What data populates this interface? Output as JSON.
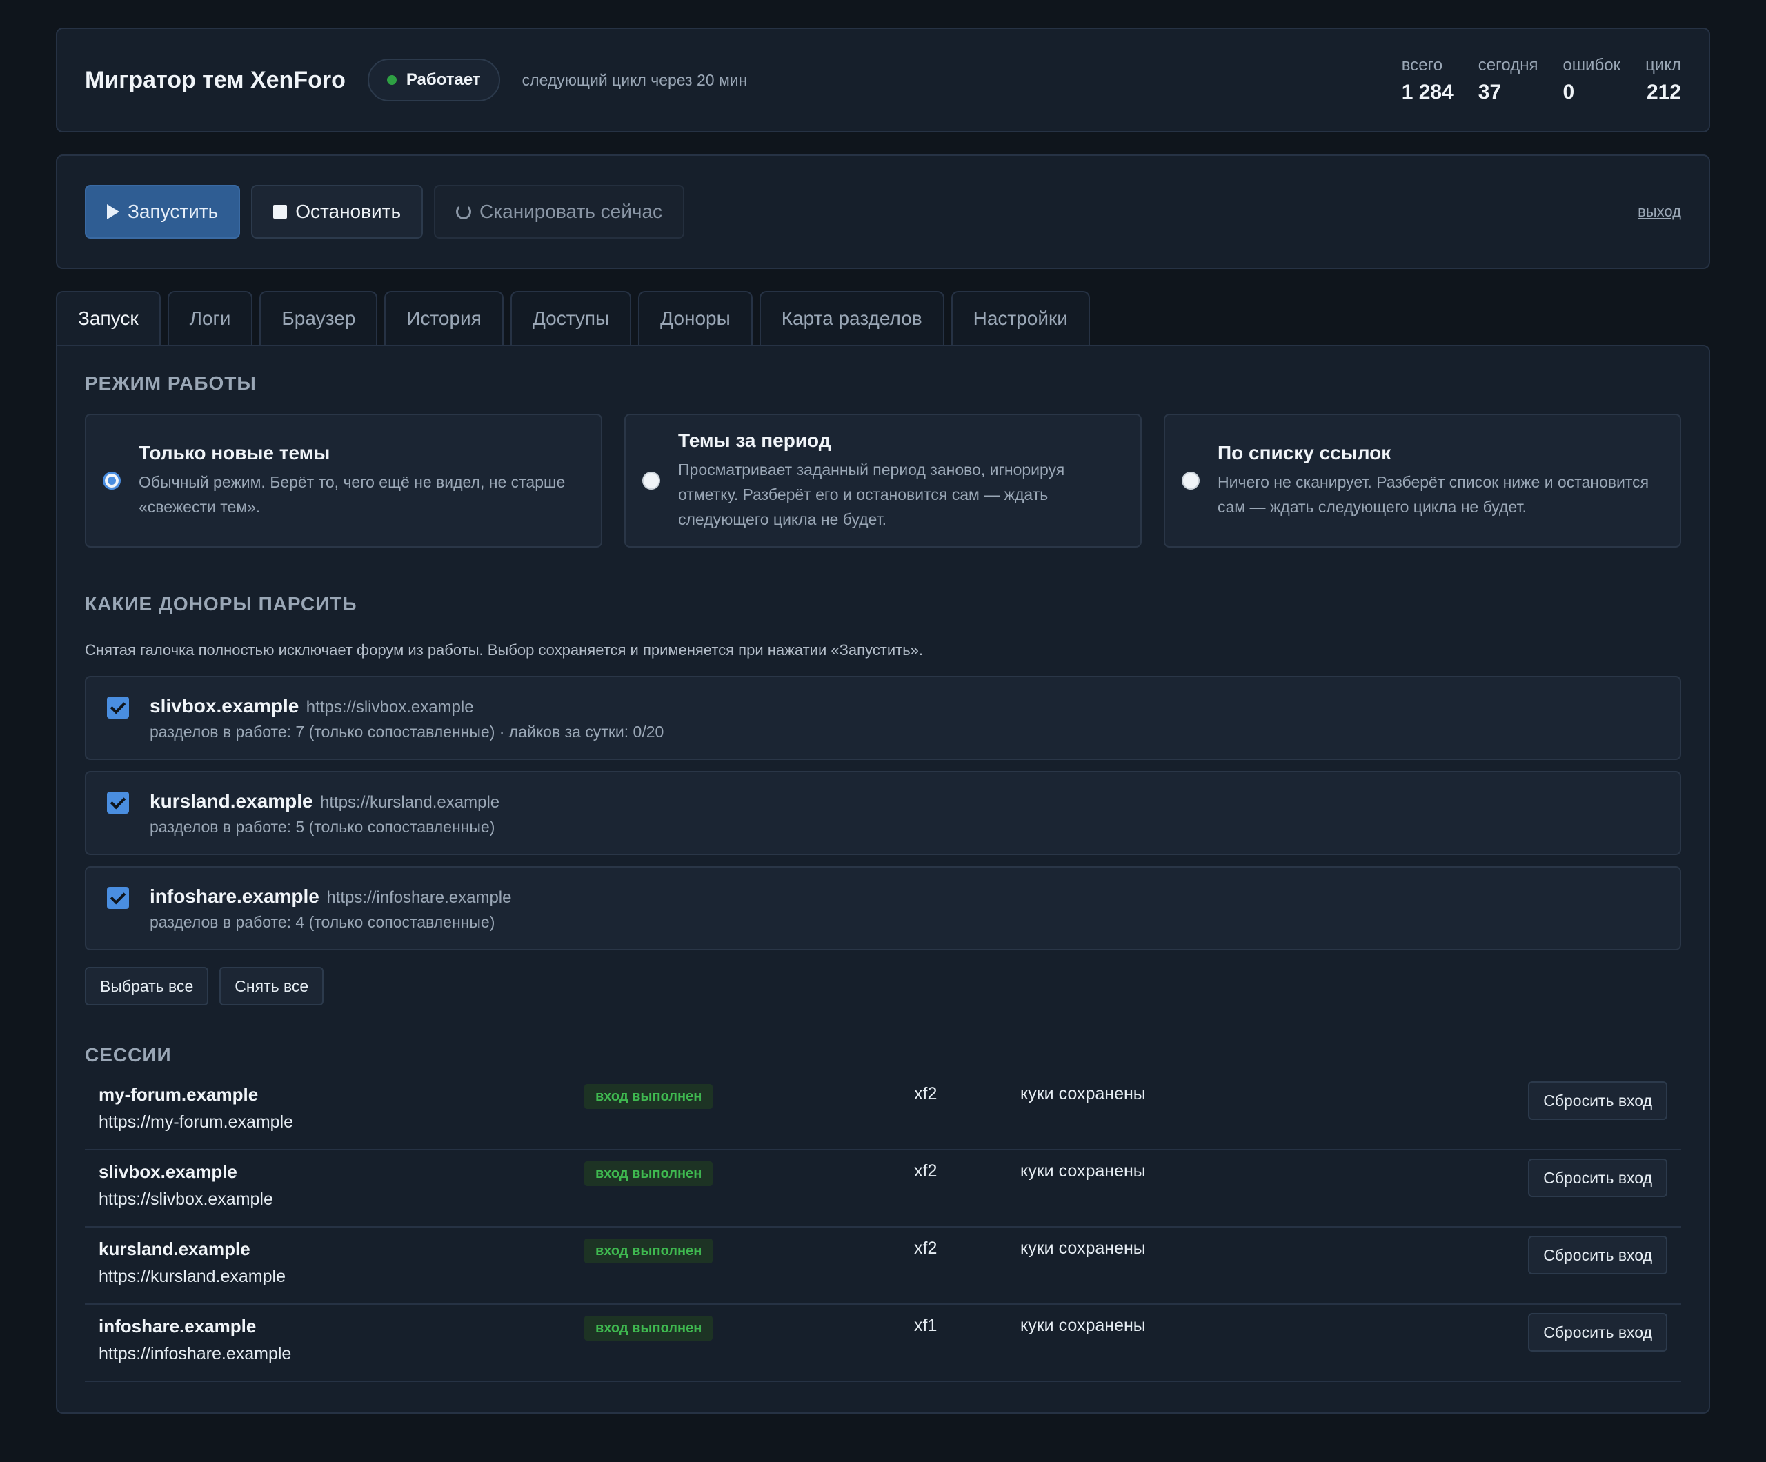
{
  "header": {
    "title": "Мигратор тем XenForo",
    "status": "Работает",
    "next_cycle": "следующий цикл через 20 мин",
    "stats": [
      {
        "label": "всего",
        "value": "1 284"
      },
      {
        "label": "сегодня",
        "value": "37"
      },
      {
        "label": "ошибок",
        "value": "0"
      },
      {
        "label": "цикл",
        "value": "212"
      }
    ]
  },
  "controls": {
    "start": "Запустить",
    "stop": "Остановить",
    "scan": "Сканировать сейчас",
    "logout": "выход"
  },
  "tabs": [
    "Запуск",
    "Логи",
    "Браузер",
    "История",
    "Доступы",
    "Доноры",
    "Карта разделов",
    "Настройки"
  ],
  "mode": {
    "section_title": "Режим работы",
    "options": [
      {
        "title": "Только новые темы",
        "desc": "Обычный режим. Берёт то, чего ещё не видел, не старше «свежести тем».",
        "checked": true
      },
      {
        "title": "Темы за период",
        "desc": "Просматривает заданный период заново, игнорируя отметку. Разберёт его и остановится сам — ждать следующего цикла не будет.",
        "checked": false
      },
      {
        "title": "По списку ссылок",
        "desc": "Ничего не сканирует. Разберёт список ниже и остановится сам — ждать следующего цикла не будет.",
        "checked": false
      }
    ]
  },
  "donors": {
    "section_title": "Какие доноры парсить",
    "hint": "Снятая галочка полностью исключает форум из работы. Выбор сохраняется и применяется при нажатии «Запустить».",
    "items": [
      {
        "name": "slivbox.example",
        "url": "https://slivbox.example",
        "meta": "разделов в работе: 7 (только сопоставленные) · лайков за сутки: 0/20",
        "checked": true
      },
      {
        "name": "kursland.example",
        "url": "https://kursland.example",
        "meta": "разделов в работе: 5 (только сопоставленные)",
        "checked": true
      },
      {
        "name": "infoshare.example",
        "url": "https://infoshare.example",
        "meta": "разделов в работе: 4 (только сопоставленные)",
        "checked": true
      }
    ],
    "select_all": "Выбрать все",
    "deselect_all": "Снять все"
  },
  "sessions": {
    "section_title": "Сессии",
    "rows": [
      {
        "name": "my-forum.example",
        "url": "https://my-forum.example",
        "status": "вход выполнен",
        "engine": "xf2",
        "cookies": "куки сохранены",
        "reset": "Сбросить вход"
      },
      {
        "name": "slivbox.example",
        "url": "https://slivbox.example",
        "status": "вход выполнен",
        "engine": "xf2",
        "cookies": "куки сохранены",
        "reset": "Сбросить вход"
      },
      {
        "name": "kursland.example",
        "url": "https://kursland.example",
        "status": "вход выполнен",
        "engine": "xf2",
        "cookies": "куки сохранены",
        "reset": "Сбросить вход"
      },
      {
        "name": "infoshare.example",
        "url": "https://infoshare.example",
        "status": "вход выполнен",
        "engine": "xf1",
        "cookies": "куки сохранены",
        "reset": "Сбросить вход"
      }
    ]
  },
  "colors": {
    "accent": "#4a8ee0",
    "primary_button": "#2f5d93",
    "success": "#3fb950",
    "background": "#0f151c",
    "card": "#161f2b"
  }
}
